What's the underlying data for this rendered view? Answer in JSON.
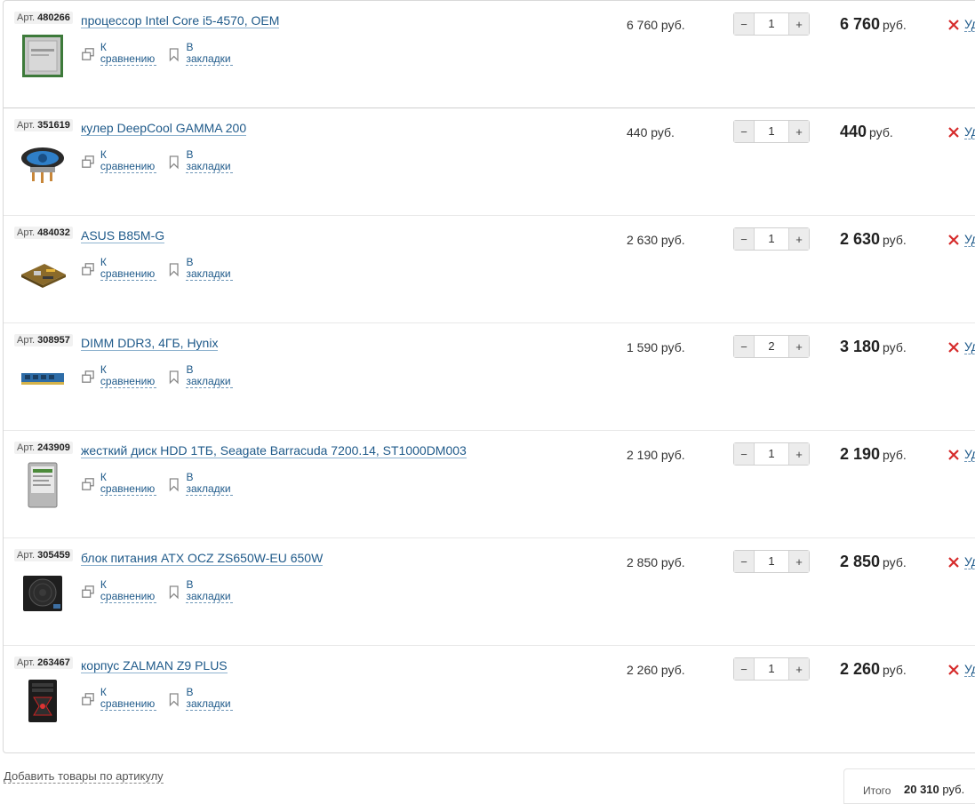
{
  "labels": {
    "art_prefix": "Арт.",
    "compare": "К сравнению",
    "bookmark": "В закладки",
    "delete": "Уд",
    "currency": "руб.",
    "minus": "−",
    "plus": "+"
  },
  "items": [
    {
      "art": "480266",
      "title": "процессор Intel Core i5-4570, OEM",
      "unit_price": "6 760 руб.",
      "qty": "1",
      "total": "6 760",
      "thumb_icon": "cpu-icon"
    },
    {
      "art": "351619",
      "title": "кулер DeepCool GAMMA 200",
      "unit_price": "440 руб.",
      "qty": "1",
      "total": "440",
      "thumb_icon": "cooler-icon"
    },
    {
      "art": "484032",
      "title": "ASUS B85M-G",
      "unit_price": "2 630 руб.",
      "qty": "1",
      "total": "2 630",
      "thumb_icon": "motherboard-icon"
    },
    {
      "art": "308957",
      "title": "DIMM DDR3, 4ГБ, Hynix",
      "unit_price": "1 590 руб.",
      "qty": "2",
      "total": "3 180",
      "thumb_icon": "ram-icon"
    },
    {
      "art": "243909",
      "title": "жесткий диск HDD 1ТБ, Seagate Barracuda 7200.14, ST1000DM003",
      "unit_price": "2 190 руб.",
      "qty": "1",
      "total": "2 190",
      "thumb_icon": "hdd-icon"
    },
    {
      "art": "305459",
      "title": "блок питания ATX OCZ ZS650W-EU 650W",
      "unit_price": "2 850 руб.",
      "qty": "1",
      "total": "2 850",
      "thumb_icon": "psu-icon"
    },
    {
      "art": "263467",
      "title": "корпус ZALMAN Z9 PLUS",
      "unit_price": "2 260 руб.",
      "qty": "1",
      "total": "2 260",
      "thumb_icon": "case-icon"
    }
  ],
  "footer": {
    "add_by_article": "Добавить товары по артикулу",
    "total_label": "Итого",
    "total_value": "20 310",
    "total_currency": "руб."
  },
  "colors": {
    "link": "#1f5a8a",
    "delete_x": "#d62b2b"
  }
}
